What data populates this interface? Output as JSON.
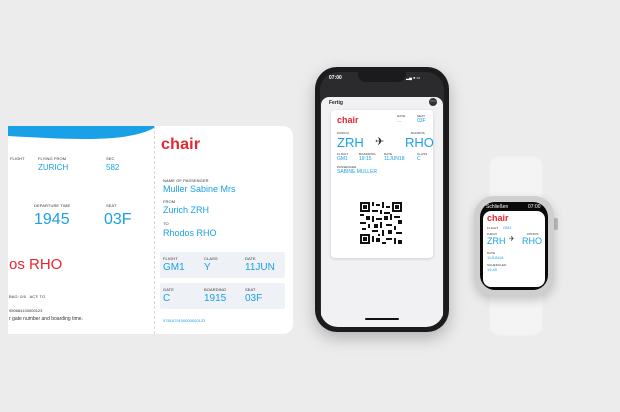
{
  "pass_left": {
    "flight_label": "FLIGHT",
    "flying_from_label": "FLYING FROM",
    "flying_from": "ZURICH",
    "sec_label": "SEC",
    "sec": "582",
    "departure_label": "DEPARTURE TIME",
    "departure": "1945",
    "seat_label": "SEAT",
    "seat": "03F",
    "dest_fragment": "os RHO",
    "bag_line": "BAG: 0/0   ACT: TO",
    "number_line": "950684100000123",
    "note": "r gate number and boarding time."
  },
  "pass_right": {
    "brand": "chair",
    "passenger_label": "NAME OF PASSENGER",
    "passenger": "Muller Sabine Mrs",
    "from_label": "FROM",
    "from": "Zurich ZRH",
    "to_label": "TO",
    "to": "Rhodos RHO",
    "flight_label": "FLIGHT",
    "flight": "GM1",
    "class_label": "CLASS",
    "class": "Y",
    "date_label": "DATE",
    "date": "11JUN",
    "gate_label": "GATE",
    "gate": "C",
    "boarding_label": "BOARDING",
    "boarding": "1915",
    "seat_label": "SEAT",
    "seat": "03F",
    "ticket": "9781679100000000123"
  },
  "phone": {
    "time": "07:00",
    "status_icons": "▂▄ ● ▭",
    "done_button": "Fertig",
    "brand": "chair",
    "date_label": "DATE",
    "date": "...",
    "seat_label": "SEAT",
    "seat": "03F",
    "origin_label": "ZURICH",
    "origin": "ZRH",
    "dest_label": "RHODOS",
    "dest": "RHO",
    "flight_label": "FLIGHT",
    "flight": "GM1",
    "boarding_label": "BOARDING",
    "boarding": "19:15",
    "date2_label": "DATE",
    "date2": "11JUN18",
    "class_label": "CLASS",
    "class": "C",
    "passenger_label": "PASSENGER",
    "passenger": "SABINE MULLER"
  },
  "watch": {
    "close": "Schließen",
    "time": "07:00",
    "brand": "chair",
    "flight_label": "FLIGHT",
    "flight": "GM1",
    "origin_label": "ZURICH",
    "origin": "ZRH",
    "dest_label": "RHODOS",
    "dest": "RHO",
    "date_label": "DATE",
    "date": "11JUN18",
    "scheduled_label": "SCHEDULED",
    "scheduled": "19:45"
  },
  "colors": {
    "accent": "#1aa0e6",
    "brand_red": "#e3262f",
    "background": "#ececec"
  }
}
